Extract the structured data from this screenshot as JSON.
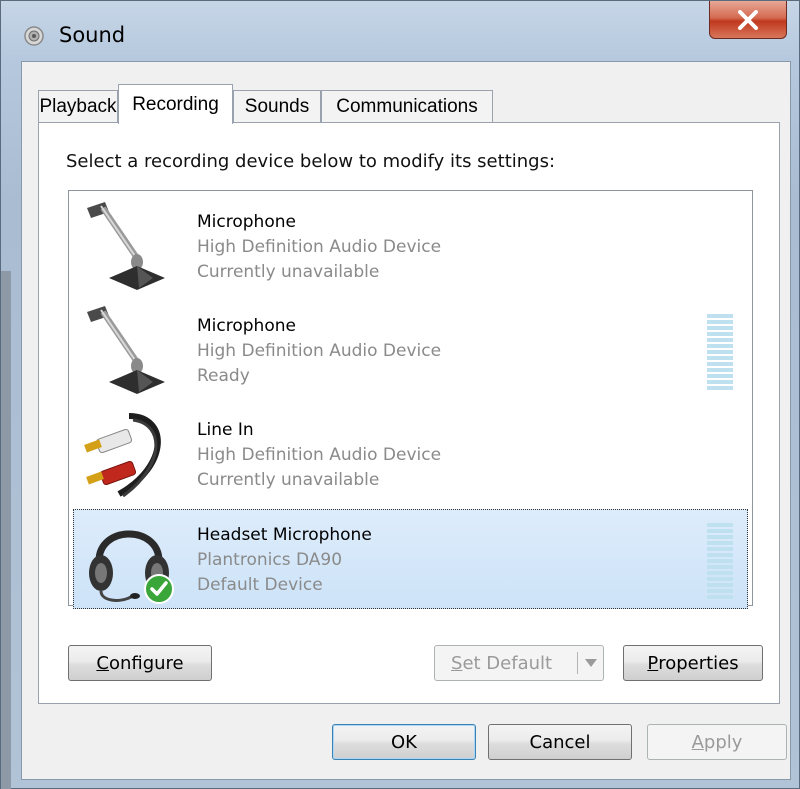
{
  "window": {
    "title": "Sound",
    "close_label": "X"
  },
  "tabs": [
    {
      "label": "Playback",
      "active": false
    },
    {
      "label": "Recording",
      "active": true
    },
    {
      "label": "Sounds",
      "active": false
    },
    {
      "label": "Communications",
      "active": false
    }
  ],
  "recording": {
    "instruction": "Select a recording device below to modify its settings:",
    "devices": [
      {
        "name": "Microphone",
        "driver": "High Definition Audio Device",
        "status": "Currently unavailable",
        "icon": "microphone-icon",
        "selected": false,
        "level_meter": false
      },
      {
        "name": "Microphone",
        "driver": "High Definition Audio Device",
        "status": "Ready",
        "icon": "microphone-icon",
        "selected": false,
        "level_meter": true
      },
      {
        "name": "Line In",
        "driver": "High Definition Audio Device",
        "status": "Currently unavailable",
        "icon": "rca-cable-icon",
        "selected": false,
        "level_meter": false
      },
      {
        "name": "Headset Microphone",
        "driver": "Plantronics DA90",
        "status": "Default Device",
        "icon": "headset-icon",
        "selected": true,
        "level_meter": true,
        "default_badge": "check-icon"
      }
    ],
    "buttons": {
      "configure_first": "C",
      "configure_rest": "onfigure",
      "set_default_first": "S",
      "set_default_rest": "et Default",
      "properties_first": "P",
      "properties_rest": "roperties"
    }
  },
  "footer": {
    "ok": "OK",
    "cancel": "Cancel",
    "apply_first": "A",
    "apply_rest": "pply"
  },
  "colors": {
    "selection": "#cde3f8",
    "meter": "#bfe0ee",
    "disabled_text": "#9a9a9a",
    "secondary_text": "#8a8a8a"
  }
}
